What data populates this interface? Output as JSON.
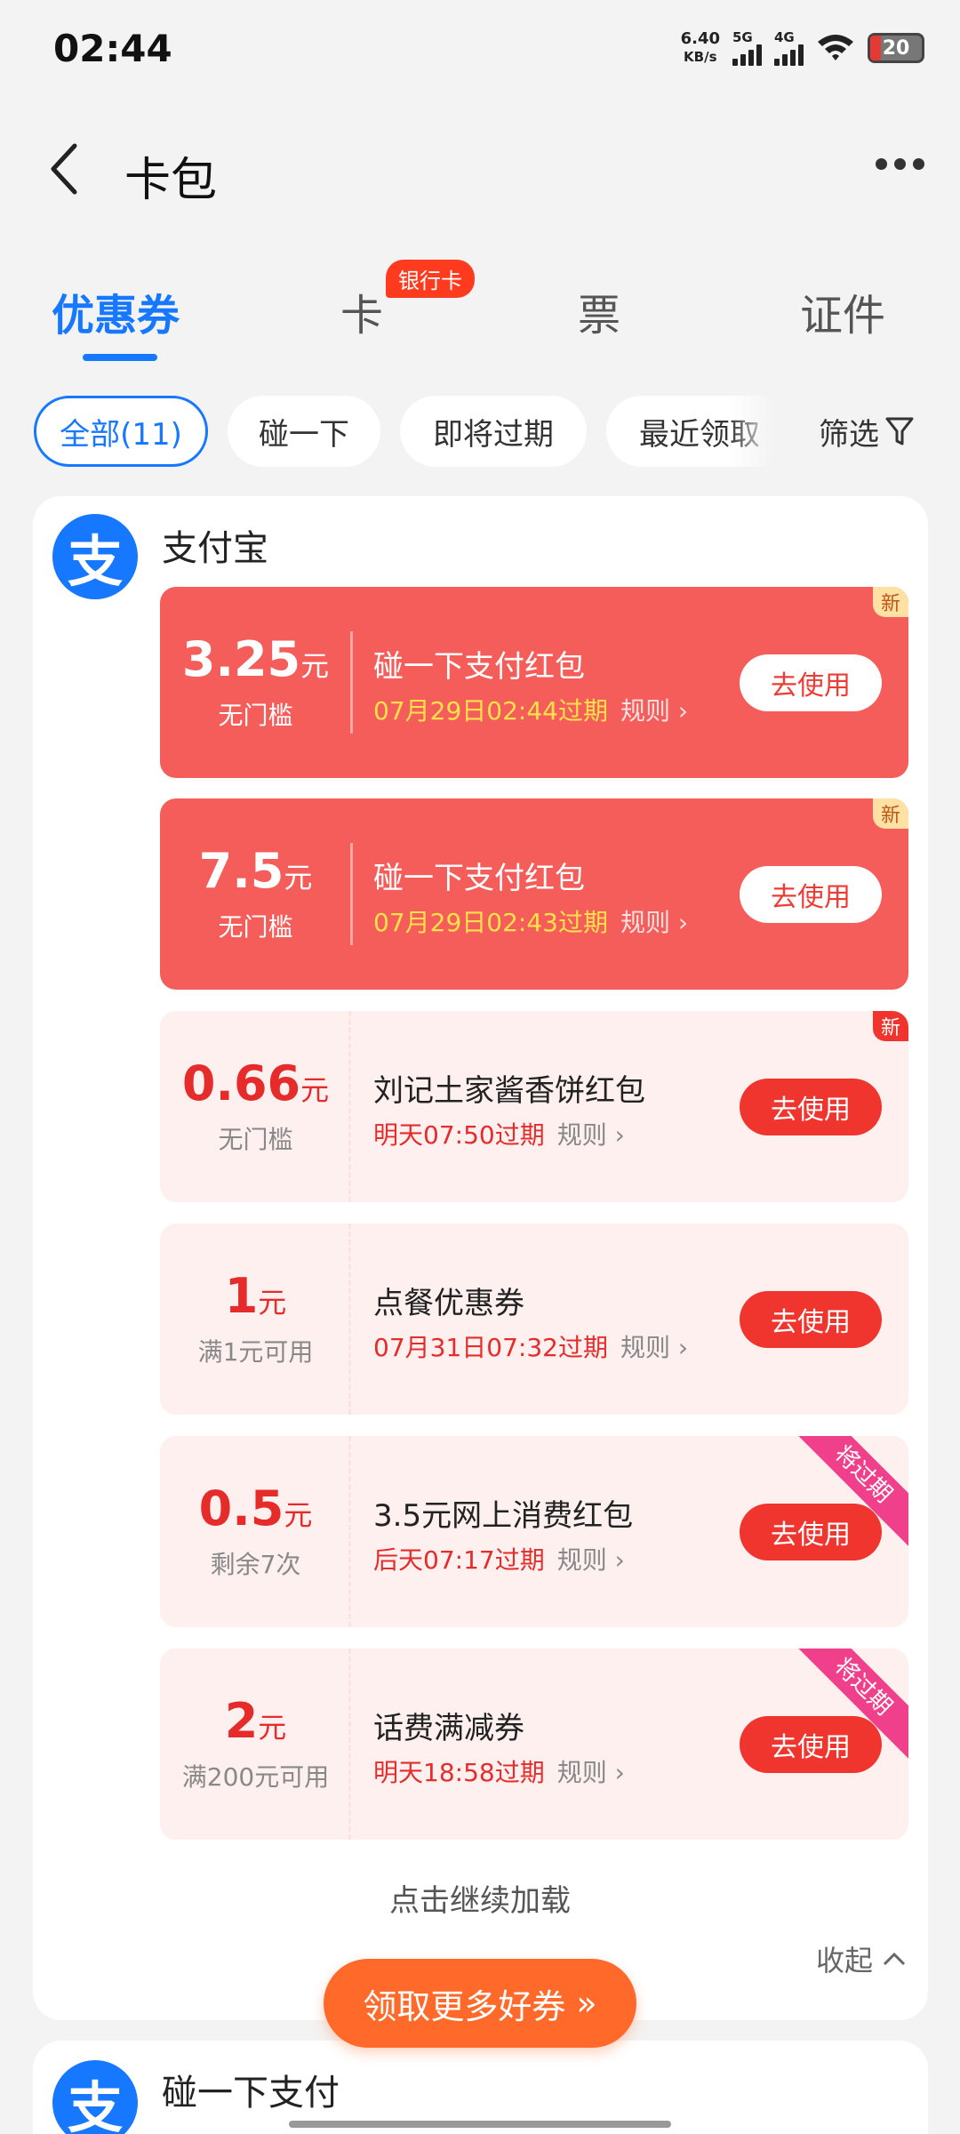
{
  "status_bar": {
    "time": "02:44",
    "net_speed_value": "6.40",
    "net_speed_unit": "KB/s",
    "signal_1": "5G",
    "signal_2": "4G",
    "battery": "20"
  },
  "header": {
    "title": "卡包"
  },
  "tabs": [
    {
      "label": "优惠券",
      "active": true
    },
    {
      "label": "卡",
      "badge": "银行卡"
    },
    {
      "label": "票"
    },
    {
      "label": "证件"
    }
  ],
  "filters": [
    {
      "label": "全部(11)",
      "active": true
    },
    {
      "label": "碰一下"
    },
    {
      "label": "即将过期"
    },
    {
      "label": "最近领取"
    }
  ],
  "filter_button": "筛选",
  "sections": [
    {
      "name": "支付宝",
      "logo_char": "支",
      "coupons": [
        {
          "amount": "3.25",
          "unit": "元",
          "condition": "无门槛",
          "name": "碰一下支付红包",
          "expiry": "07月29日02:44过期",
          "rule": "规则",
          "button": "去使用",
          "tag": "新",
          "style": "red"
        },
        {
          "amount": "7.5",
          "unit": "元",
          "condition": "无门槛",
          "name": "碰一下支付红包",
          "expiry": "07月29日02:43过期",
          "rule": "规则",
          "button": "去使用",
          "tag": "新",
          "style": "red"
        },
        {
          "amount": "0.66",
          "unit": "元",
          "condition": "无门槛",
          "name": "刘记土家酱香饼红包",
          "expiry": "明天07:50过期",
          "rule": "规则",
          "button": "去使用",
          "tag": "新",
          "style": "pink"
        },
        {
          "amount": "1",
          "unit": "元",
          "condition": "满1元可用",
          "name": "点餐优惠券",
          "expiry": "07月31日07:32过期",
          "rule": "规则",
          "button": "去使用",
          "style": "pink"
        },
        {
          "amount": "0.5",
          "unit": "元",
          "condition": "剩余7次",
          "name": "3.5元网上消费红包",
          "expiry": "后天07:17过期",
          "rule": "规则",
          "button": "去使用",
          "ribbon": "将过期",
          "style": "pink"
        },
        {
          "amount": "2",
          "unit": "元",
          "condition": "满200元可用",
          "name": "话费满减券",
          "expiry": "明天18:58过期",
          "rule": "规则",
          "button": "去使用",
          "ribbon": "将过期",
          "style": "pink"
        }
      ],
      "load_more": "点击继续加载",
      "collapse": "收起"
    },
    {
      "name": "碰一下支付",
      "logo_char": "支"
    }
  ],
  "get_more_button": "领取更多好券",
  "colors": {
    "brand_blue": "#1677ff",
    "coupon_red": "#f45d59",
    "coupon_pink": "#fff0f0",
    "button_red": "#f0352f",
    "orange": "#ff6a2a"
  }
}
